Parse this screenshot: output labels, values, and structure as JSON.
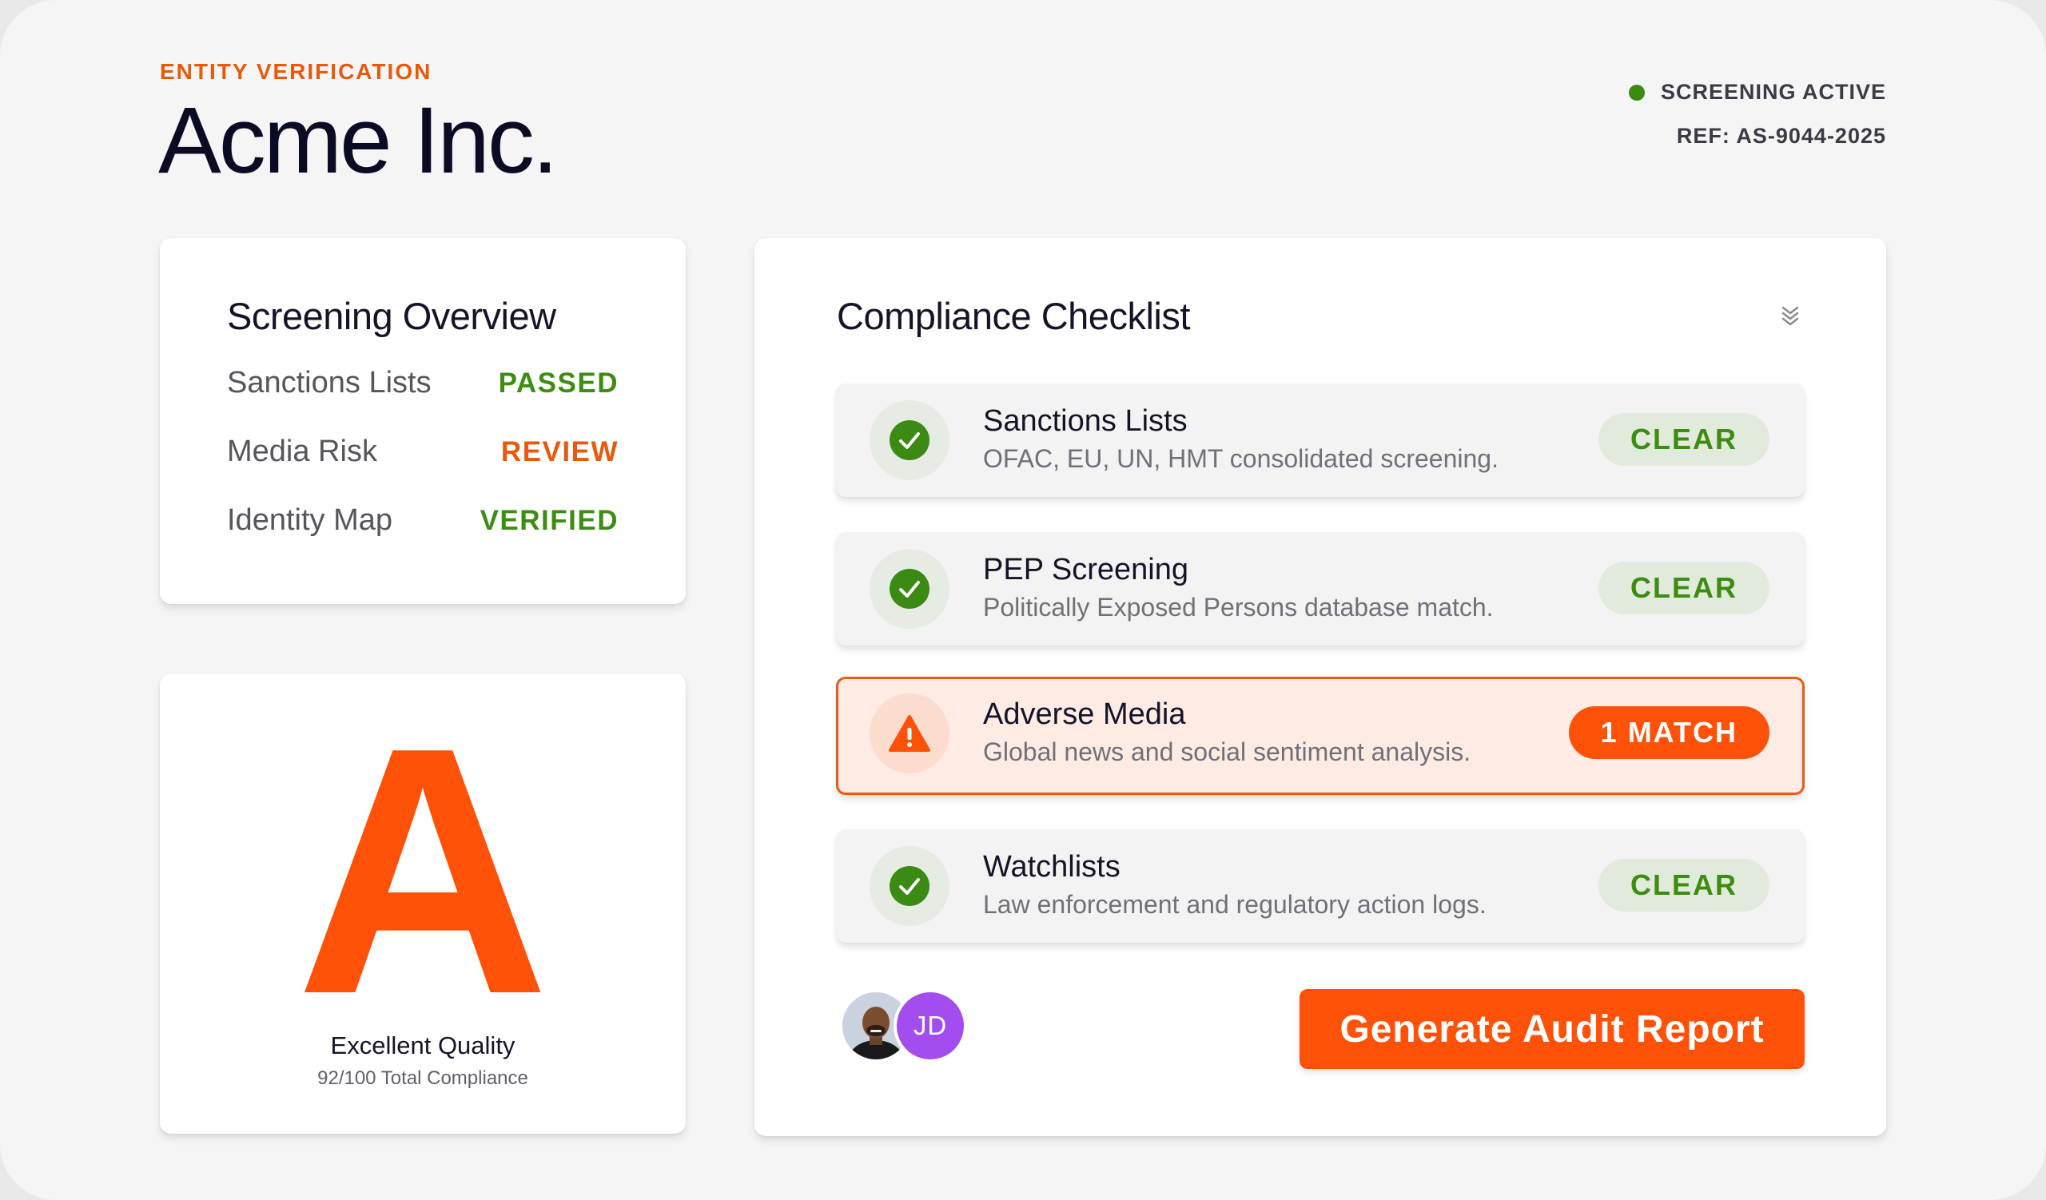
{
  "header": {
    "eyebrow": "ENTITY VERIFICATION",
    "title": "Acme Inc.",
    "status": "SCREENING ACTIVE",
    "status_color": "#3b8a12",
    "reference": "REF: AS-9044-2025"
  },
  "overview": {
    "title": "Screening Overview",
    "rows": [
      {
        "label": "Sanctions Lists",
        "status": "PASSED",
        "color": "#3d8d13"
      },
      {
        "label": "Media Risk",
        "status": "REVIEW",
        "color": "#e8590c"
      },
      {
        "label": "Identity Map",
        "status": "VERIFIED",
        "color": "#3d8d13"
      }
    ]
  },
  "grade": {
    "letter": "A",
    "title": "Excellent Quality",
    "subtitle": "92/100 Total Compliance"
  },
  "checklist": {
    "title": "Compliance Checklist",
    "collapse_icon": "chevrons-down-icon",
    "items": [
      {
        "title": "Sanctions Lists",
        "description": "OFAC, EU, UN, HMT consolidated screening.",
        "badge": "CLEAR",
        "icon": "check-circle-icon",
        "state": "clear"
      },
      {
        "title": "PEP Screening",
        "description": "Politically Exposed Persons database match.",
        "badge": "CLEAR",
        "icon": "check-circle-icon",
        "state": "clear"
      },
      {
        "title": "Adverse Media",
        "description": "Global news and social sentiment analysis.",
        "badge": "1 MATCH",
        "icon": "warning-triangle-icon",
        "state": "alert"
      },
      {
        "title": "Watchlists",
        "description": "Law enforcement and regulatory action logs.",
        "badge": "CLEAR",
        "icon": "check-circle-icon",
        "state": "clear"
      }
    ]
  },
  "collaborators": {
    "initials": "JD"
  },
  "actions": {
    "audit_label": "Generate Audit Report"
  },
  "colors": {
    "accent": "#ff5208",
    "success": "#3d8d13",
    "warning": "#e8590c"
  }
}
